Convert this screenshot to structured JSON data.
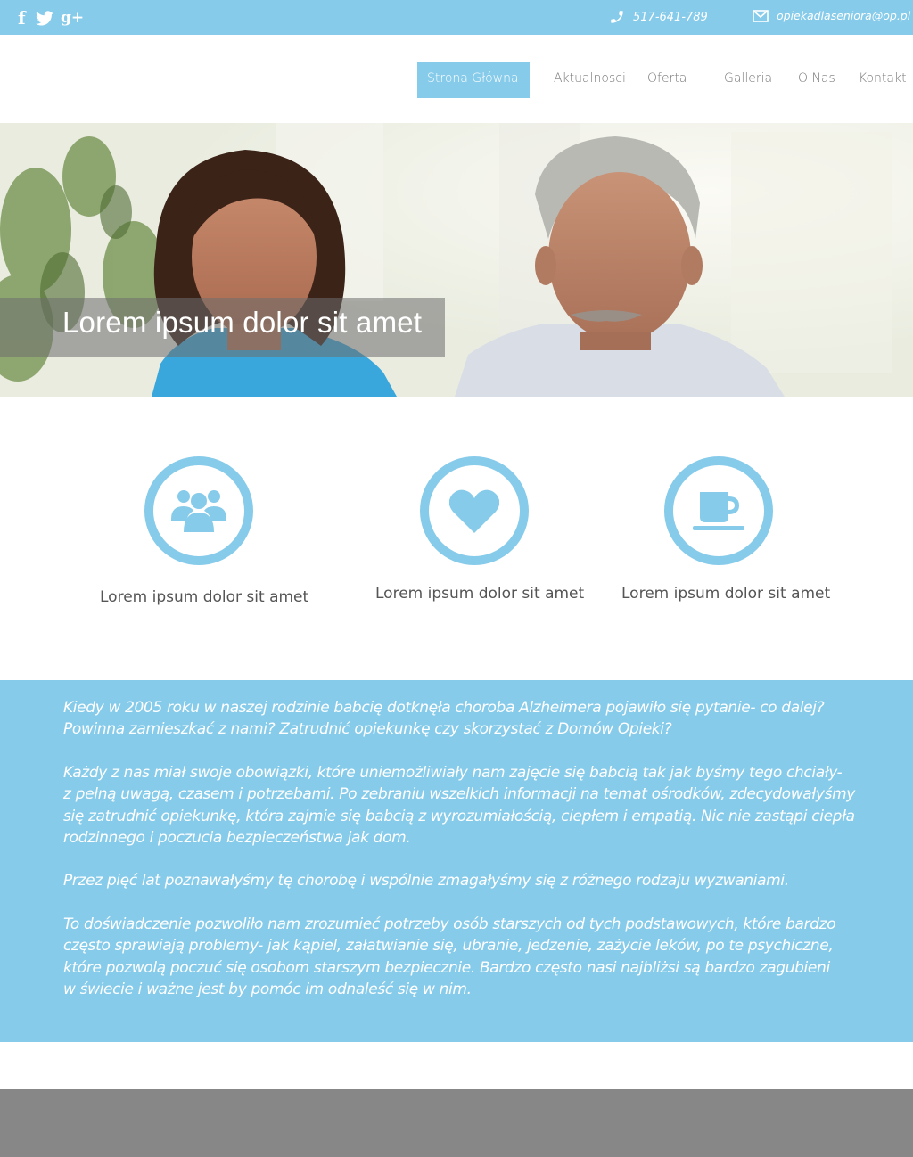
{
  "topbar": {
    "social": [
      "facebook-icon",
      "twitter-icon",
      "google-plus-icon"
    ],
    "phone": "517-641-789",
    "email": "opiekadlaseniora@op.pl"
  },
  "nav": {
    "items": [
      {
        "label": "Strona Główna",
        "active": true
      },
      {
        "label": "Aktualnosci",
        "active": false
      },
      {
        "label": "Oferta",
        "active": false
      },
      {
        "label": "Galleria",
        "active": false
      },
      {
        "label": "O Nas",
        "active": false
      },
      {
        "label": "Kontakt",
        "active": false
      }
    ]
  },
  "hero": {
    "title": "Lorem ipsum dolor sit amet"
  },
  "features": [
    {
      "icon": "people-icon",
      "label": "Lorem ipsum dolor sit amet"
    },
    {
      "icon": "heart-icon",
      "label": "Lorem ipsum dolor sit amet"
    },
    {
      "icon": "coffee-cup-icon",
      "label": "Lorem ipsum dolor sit amet"
    }
  ],
  "story": {
    "paragraphs": [
      "Kiedy w 2005 roku w naszej rodzinie babcię dotknęła choroba Alzheimera pojawiło się pytanie- co dalej?\nPowinna zamieszkać z nami? Zatrudnić opiekunkę czy skorzystać z Domów Opieki?",
      "Każdy z nas miał swoje obowiązki, które uniemożliwiały nam zajęcie się babcią tak jak byśmy tego chciały-\nz pełną uwagą, czasem i potrzebami. Po zebraniu wszelkich informacji na temat ośrodków, zdecydowałyśmy\nsię zatrudnić opiekunkę, która zajmie się babcią z wyrozumiałością, ciepłem i empatią. Nic nie zastąpi ciepła\nrodzinnego i poczucia bezpieczeństwa jak dom.",
      "Przez pięć lat poznawałyśmy tę chorobę i wspólnie zmagałyśmy się z różnego rodzaju wyzwaniami.",
      "To doświadczenie pozwoliło nam zrozumieć potrzeby osób starszych od tych podstawowych, które bardzo\nczęsto sprawiają problemy- jak kąpiel, załatwianie się, ubranie, jedzenie, zażycie leków, po te psychiczne,\nktóre pozwolą poczuć się osobom starszym bezpiecznie. Bardzo często nasi najbliżsi są bardzo zagubieni\nw świecie i ważne jest by pomóc im odnaleść się w nim."
    ]
  },
  "colors": {
    "accent": "#86cbea",
    "footer": "#878787",
    "text": "#555555"
  }
}
